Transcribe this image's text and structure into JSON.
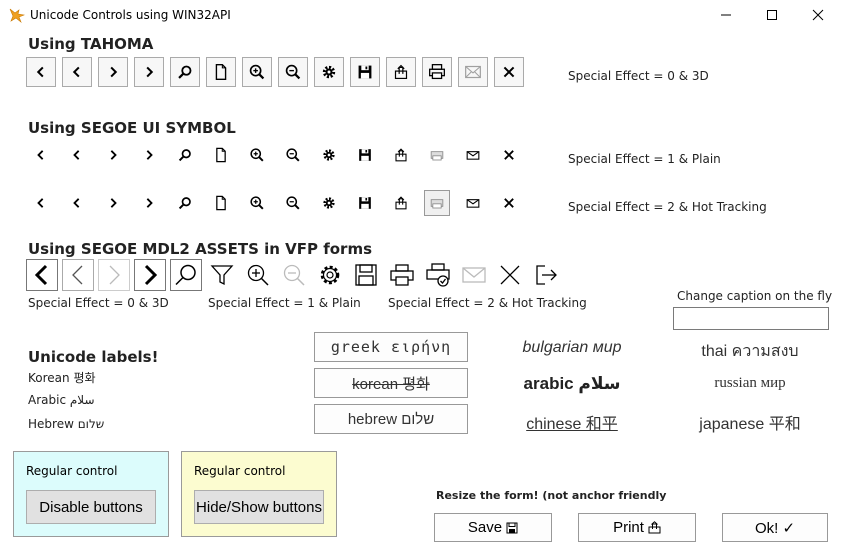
{
  "window": {
    "title": "Unicode Controls using WIN32API",
    "minimize": "—",
    "maximize": "☐",
    "close": "✕"
  },
  "tahoma": {
    "heading": "Using TAHOMA",
    "effect": "Special Effect = 0 & 3D",
    "buttons": [
      "first-icon",
      "previous-icon",
      "next-icon",
      "last-icon",
      "search-icon",
      "document-icon",
      "zoom-in-icon",
      "zoom-out-icon",
      "gear-icon",
      "save-icon",
      "share-icon",
      "printer-icon",
      "mail-icon",
      "close-icon"
    ]
  },
  "segoe": {
    "heading": "Using SEGOE UI SYMBOL",
    "effect1": "Special Effect = 1 & Plain",
    "effect2": "Special Effect = 2 & Hot Tracking"
  },
  "mdl2": {
    "heading": "Using SEGOE MDL2 ASSETS in VFP forms",
    "effect0": "Special Effect = 0 & 3D",
    "effect1": "Special Effect = 1 & Plain",
    "effect2": "Special Effect = 2 & Hot Tracking"
  },
  "caption": {
    "label": "Change caption on the fly",
    "value": ""
  },
  "unicode_labels": {
    "heading": "Unicode labels!",
    "korean": "Korean 평화",
    "arabic": "Arabic سلام",
    "hebrew": "Hebrew שלום"
  },
  "lang_buttons": {
    "greek": "greek ειρήνη",
    "korean": "korean 평화",
    "hebrew": "hebrew שלום"
  },
  "lang_labels": {
    "bulgarian": "bulgarian мир",
    "thai": "thai ความสงบ",
    "arabic": "arabic سلام",
    "russian": "russian мир",
    "chinese": "chinese 和平",
    "japanese": "japanese 平和"
  },
  "panels": {
    "left_title": "Regular control",
    "left_button": "Disable buttons",
    "right_title": "Regular control",
    "right_button": "Hide/Show buttons",
    "left_bg": "#dcfcfc",
    "right_bg": "#fcfcd0"
  },
  "footer": {
    "resize_note": "Resize the form! (not anchor friendly",
    "save": "Save",
    "print": "Print",
    "ok": "Ok! ✓"
  }
}
